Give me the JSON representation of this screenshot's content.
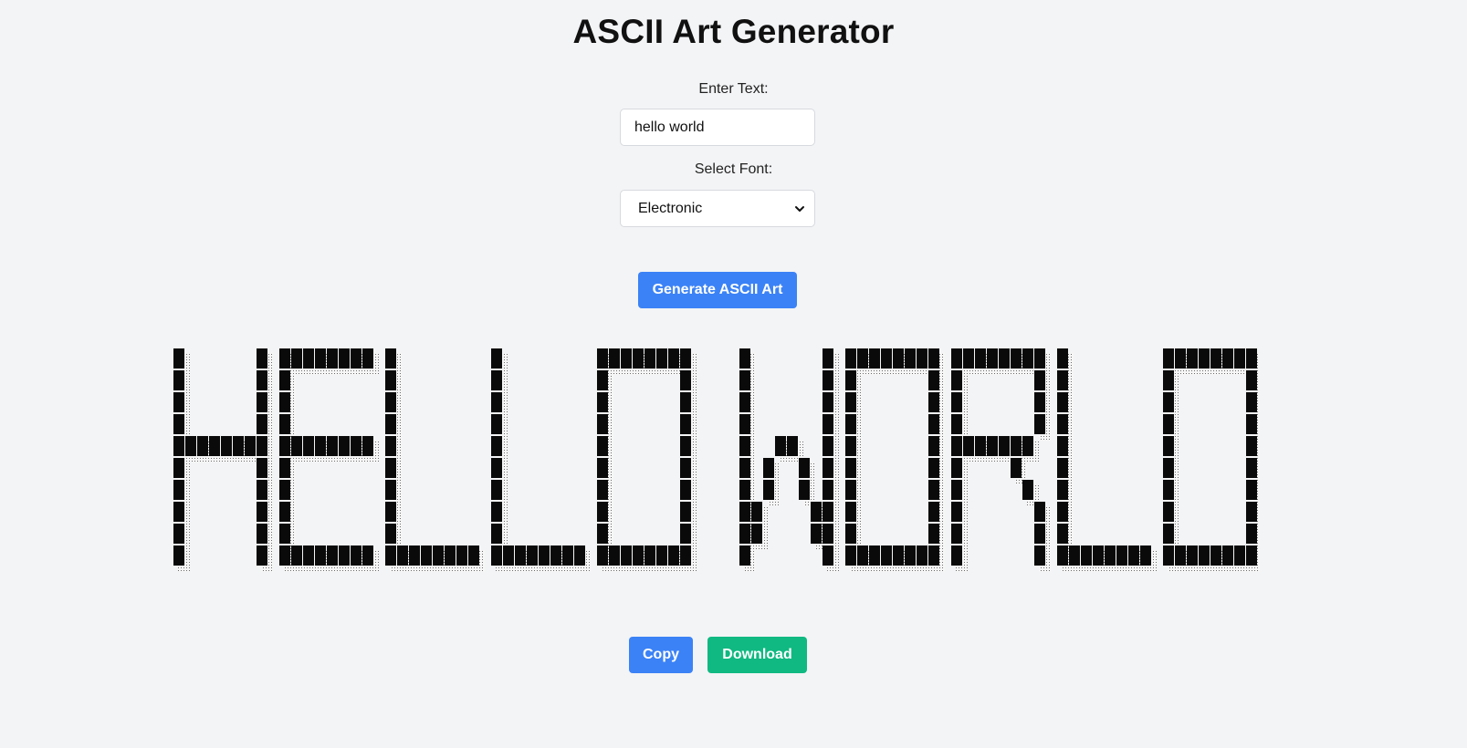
{
  "app": {
    "title": "ASCII Art Generator"
  },
  "form": {
    "text_label": "Enter Text:",
    "text_value": "hello world",
    "font_label": "Select Font:",
    "font_selected": "Electronic"
  },
  "buttons": {
    "generate": "Generate ASCII Art",
    "copy": "Copy",
    "download": "Download"
  },
  "output": {
    "text": "HELLO WORLD"
  },
  "colors": {
    "background": "#f3f4f6",
    "primary": "#3b82f6",
    "success": "#10b981"
  },
  "icons": {
    "select_arrow": "chevron-down-icon"
  }
}
